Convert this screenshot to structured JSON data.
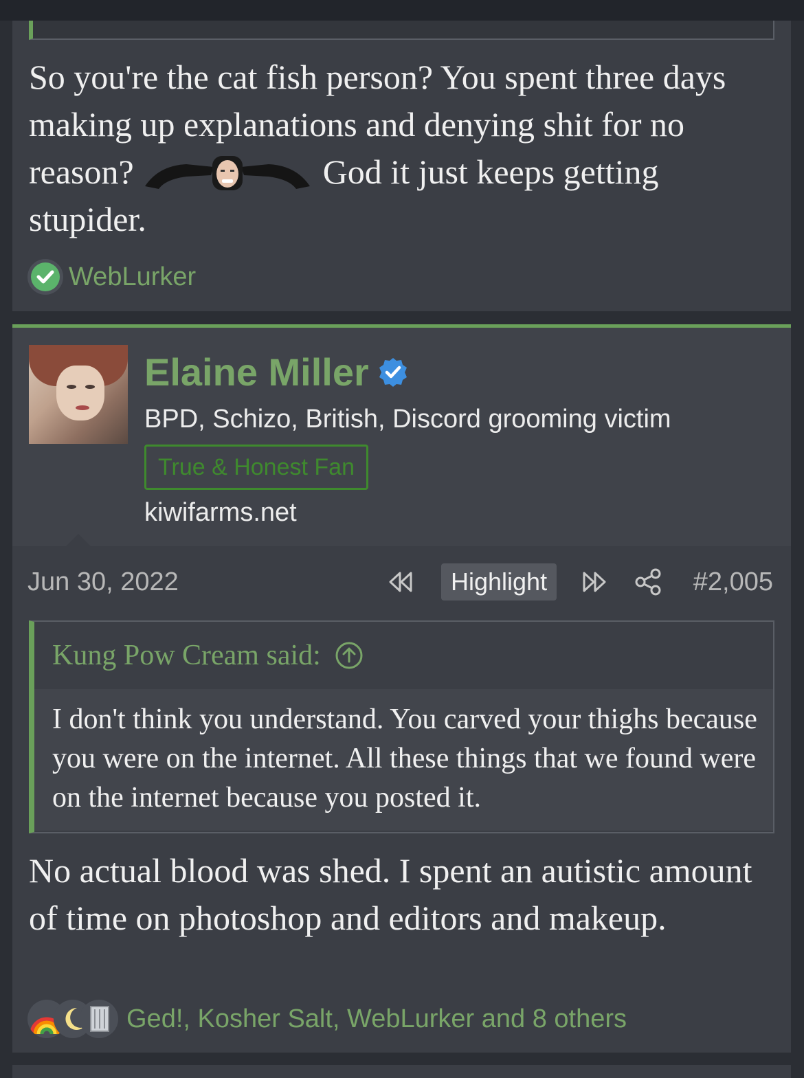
{
  "post1": {
    "body_part1": "So you're the cat fish person? You spent three days making up explanations and denying shit for no reason?",
    "body_part2": "God it just keeps getting stupider.",
    "meme_icon": "facepalm-meme-icon",
    "reaction_icon": "check-icon",
    "reaction_names": "WebLurker"
  },
  "post2": {
    "author": "Elaine Miller",
    "verified_icon": "verified-badge-icon",
    "user_title": "BPD, Schizo, British, Discord grooming victim",
    "banner": "True & Honest Fan",
    "site": "kiwifarms.net",
    "date": "Jun 30, 2022",
    "highlight_label": "Highlight",
    "post_number": "#2,005",
    "quote": {
      "attribution": "Kung Pow Cream said:",
      "text": "I don't think you understand. You carved your thighs because you were on the internet. All these things that we found were on the internet because you posted it."
    },
    "body": "No actual blood was shed. I spent an autistic amount of time on photoshop and editors and makeup.",
    "reaction_icons": [
      "rainbow-icon",
      "moon-icon",
      "trash-can-icon"
    ],
    "reaction_names": "Ged!, Kosher Salt, WebLurker and 8 others"
  },
  "colors": {
    "accent_green": "#79a568",
    "border_green": "#6aa05a",
    "verified_blue": "#3d8fe0",
    "background": "#2b2e34",
    "post_bg": "#3b3e45"
  }
}
